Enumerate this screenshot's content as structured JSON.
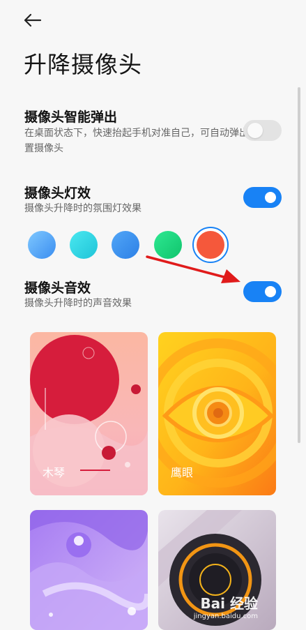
{
  "header": {
    "back_icon": "arrow-left-icon",
    "title": "升降摄像头"
  },
  "settings": [
    {
      "title": "摄像头智能弹出",
      "description": "在桌面状态下，快速抬起手机对准自己，可自动弹出前置摄像头",
      "enabled": false
    },
    {
      "title": "摄像头灯效",
      "description": "摄像头升降时的氛围灯效果",
      "enabled": true
    },
    {
      "title": "摄像头音效",
      "description": "摄像头升降时的声音效果",
      "enabled": true
    }
  ],
  "light_colors": [
    {
      "name": "light-blue",
      "color": "#4aa6f2"
    },
    {
      "name": "cyan",
      "color": "#29d6e4"
    },
    {
      "name": "blue",
      "color": "#3592ef"
    },
    {
      "name": "green",
      "color": "#17d47e"
    },
    {
      "name": "orange-red",
      "color": "#f5583b",
      "selected": true
    }
  ],
  "sound_themes": [
    {
      "label": "木琴"
    },
    {
      "label": "鹰眼"
    },
    {
      "label": ""
    },
    {
      "label": ""
    }
  ],
  "colors": {
    "accent": "#1882f5",
    "annotation_arrow": "#e01b1b"
  },
  "watermark": {
    "logo": "Bai 经验",
    "url": "jingyan.baidu.com"
  }
}
